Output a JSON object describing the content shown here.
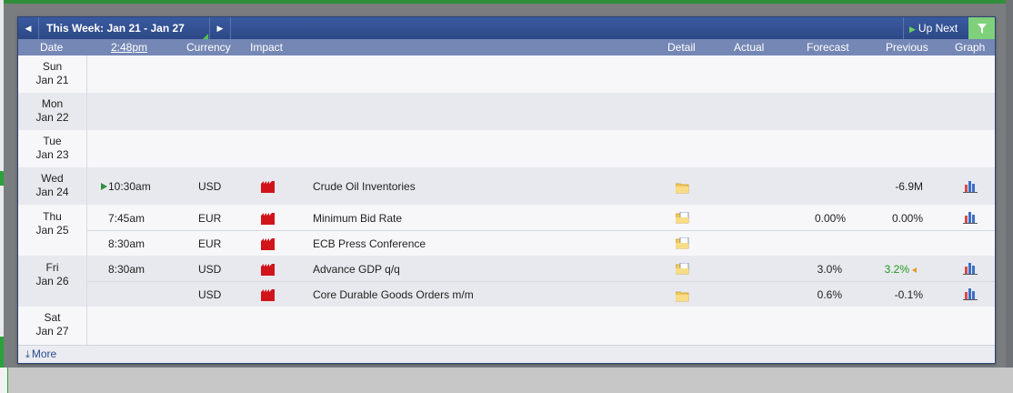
{
  "toolbar": {
    "week_label": "This Week: Jan 21 - Jan 27",
    "up_next_label": "Up Next"
  },
  "header": {
    "date": "Date",
    "time": "2:48pm",
    "currency": "Currency",
    "impact": "Impact",
    "detail": "Detail",
    "actual": "Actual",
    "forecast": "Forecast",
    "previous": "Previous",
    "graph": "Graph"
  },
  "days": [
    {
      "dow": "Sun",
      "date": "Jan 21"
    },
    {
      "dow": "Mon",
      "date": "Jan 22"
    },
    {
      "dow": "Tue",
      "date": "Jan 23"
    },
    {
      "dow": "Wed",
      "date": "Jan 24"
    },
    {
      "dow": "Thu",
      "date": "Jan 25"
    },
    {
      "dow": "Fri",
      "date": "Jan 26"
    },
    {
      "dow": "Sat",
      "date": "Jan 27"
    }
  ],
  "events": [
    {
      "time": "10:30am",
      "currency": "USD",
      "impact": "high",
      "title": "Crude Oil Inventories",
      "actual": "",
      "forecast": "",
      "previous": "-6.9M"
    },
    {
      "time": "7:45am",
      "currency": "EUR",
      "impact": "high",
      "title": "Minimum Bid Rate",
      "actual": "",
      "forecast": "0.00%",
      "previous": "0.00%"
    },
    {
      "time": "8:30am",
      "currency": "EUR",
      "impact": "high",
      "title": "ECB Press Conference",
      "actual": "",
      "forecast": "",
      "previous": ""
    },
    {
      "time": "8:30am",
      "currency": "USD",
      "impact": "high",
      "title": "Advance GDP q/q",
      "actual": "",
      "forecast": "3.0%",
      "previous": "3.2%"
    },
    {
      "time": "",
      "currency": "USD",
      "impact": "high",
      "title": "Core Durable Goods Orders m/m",
      "actual": "",
      "forecast": "0.6%",
      "previous": "-0.1%"
    }
  ],
  "footer": {
    "more_label": "More"
  },
  "colors": {
    "toolbar_bg": "#2f4c8c",
    "header_bg": "#7487b5",
    "high_impact": "#d0141a",
    "previous_better": "#1f9a1f",
    "filter_bg": "#7fd07a"
  }
}
